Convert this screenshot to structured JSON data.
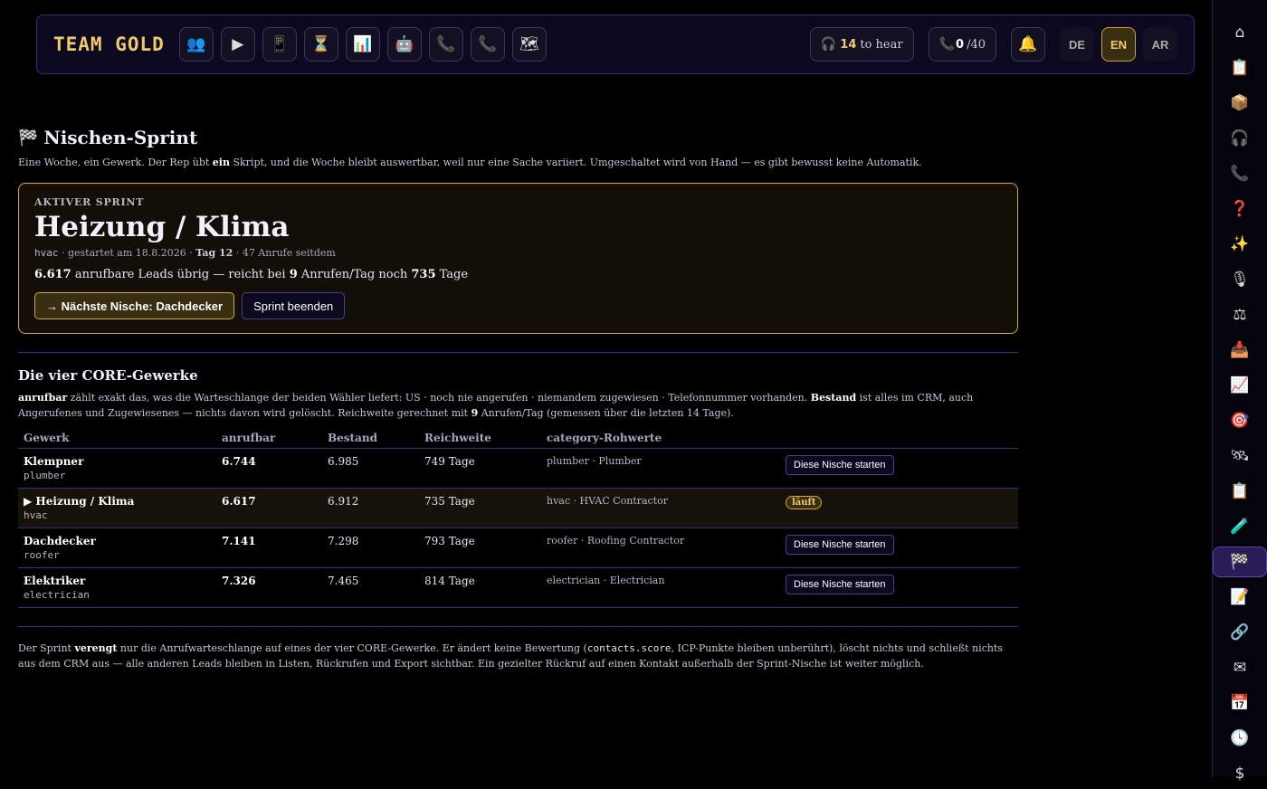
{
  "topbar": {
    "brand": "TEAM GOLD",
    "nav_icons": [
      "👥",
      "▶",
      "📱",
      "⏳",
      "📊",
      "🤖",
      "📞",
      "📞",
      "🗺"
    ],
    "listen_count": "14",
    "listen_label": "to hear",
    "calls_done": "0",
    "calls_goal": "/40",
    "bell": "🔔",
    "languages": [
      "DE",
      "EN",
      "AR"
    ],
    "active_language": "EN"
  },
  "sidebar": {
    "icons": [
      "⌂",
      "📋",
      "📦",
      "🎧",
      "📞",
      "❓",
      "✨",
      "🎙",
      "⚖",
      "📥",
      "📈",
      "🎯",
      "🛰",
      "📋",
      "🧪",
      "🏁",
      "📝",
      "🔗",
      "✉",
      "📅",
      "🕓",
      "$"
    ],
    "active_index": 15
  },
  "page": {
    "flag": "🏁",
    "title": "Nischen-Sprint",
    "intro_a": "Eine Woche, ein Gewerk. Der Rep übt ",
    "intro_b": "ein",
    "intro_c": " Skript, und die Woche bleibt auswertbar, weil nur eine Sache variiert. Umgeschaltet wird von Hand — es gibt bewusst keine Automatik."
  },
  "sprint": {
    "eyebrow": "AKTIVER SPRINT",
    "name": "Heizung / Klima",
    "code": "hvac",
    "started": " · gestartet am 18.8.2026 · ",
    "day": "Tag 12",
    "calls_since": " · 47 Anrufe seitdem",
    "leads_count": "6.617",
    "leads_a": " anrufbare Leads übrig — reicht bei ",
    "leads_rate": "9",
    "leads_b": " Anrufen/Tag noch ",
    "leads_days": "735",
    "leads_c": " Tage",
    "next_button": "→ Nächste Nische: Dachdecker",
    "end_button": "Sprint beenden"
  },
  "core": {
    "title": "Die vier CORE-Gewerke",
    "d1": "anrufbar",
    "d2": " zählt exakt das, was die Warteschlange der beiden Wähler liefert: US · noch nie angerufen · niemandem zugewiesen · Telefonnummer vorhanden. ",
    "d3": "Bestand",
    "d4": " ist alles im CRM, auch Angerufenes und Zugewiesenes — nichts davon wird gelöscht. Reichweite gerechnet mit ",
    "d5": "9",
    "d6": " Anrufen/Tag (gemessen über die letzten 14 Tage).",
    "columns": [
      "Gewerk",
      "anrufbar",
      "Bestand",
      "Reichweite",
      "category-Rohwerte",
      ""
    ],
    "rows": [
      {
        "name": "Klempner",
        "code": "plumber",
        "callable": "6.744",
        "stock": "6.985",
        "reach": "749 Tage",
        "raw": "plumber · Plumber",
        "action": "Diese Nische starten"
      },
      {
        "name": "▶ Heizung / Klima",
        "code": "hvac",
        "callable": "6.617",
        "stock": "6.912",
        "reach": "735 Tage",
        "raw": "hvac · HVAC Contractor",
        "action": "läuft"
      },
      {
        "name": "Dachdecker",
        "code": "roofer",
        "callable": "7.141",
        "stock": "7.298",
        "reach": "793 Tage",
        "raw": "roofer · Roofing Contractor",
        "action": "Diese Nische starten"
      },
      {
        "name": "Elektriker",
        "code": "electrician",
        "callable": "7.326",
        "stock": "7.465",
        "reach": "814 Tage",
        "raw": "electrician · Electrician",
        "action": "Diese Nische starten"
      }
    ]
  },
  "footer": {
    "f1": "Der Sprint ",
    "f2": "verengt",
    "f3": " nur die Anrufwarteschlange auf eines der vier CORE-Gewerke. Er ändert keine Bewertung (",
    "f4": "contacts.score",
    "f5": ", ICP-Punkte bleiben unberührt), löscht nichts und schließt nichts aus dem CRM aus — alle anderen Leads bleiben in Listen, Rückrufen und Export sichtbar. Ein gezielter Rückruf auf einen Kontakt außerhalb der Sprint-Nische ist weiter möglich."
  }
}
